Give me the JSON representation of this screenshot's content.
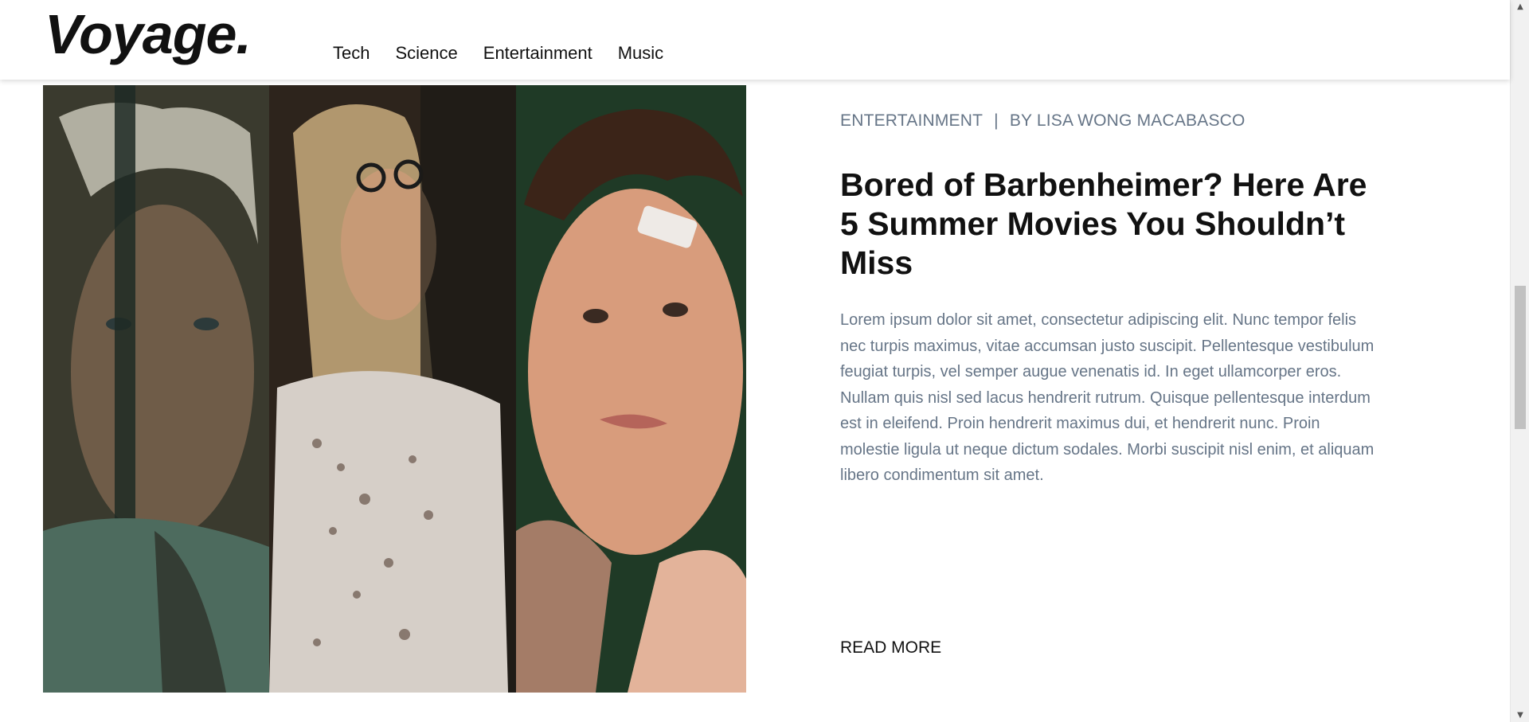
{
  "site": {
    "logo": "Voyage."
  },
  "nav": {
    "items": [
      {
        "label": "Tech"
      },
      {
        "label": "Science"
      },
      {
        "label": "Entertainment"
      },
      {
        "label": "Music"
      }
    ]
  },
  "article": {
    "category": "ENTERTAINMENT",
    "separator": "|",
    "byline": "BY LISA WONG MACABASCO",
    "title": "Bored of Barbenheimer? Here Are 5 Summer Movies You Shouldn’t Miss",
    "excerpt": "Lorem ipsum dolor sit amet, consectetur adipiscing elit. Nunc tempor felis nec turpis maximus, vitae accumsan justo suscipit. Pellentesque vestibulum feugiat turpis, vel semper augue venenatis id. In eget ullamcorper eros. Nullam quis nisl sed lacus hendrerit rutrum. Quisque pellentesque interdum est in eleifend. Proin hendrerit maximus dui, et hendrerit nunc. Proin molestie ligula ut neque dictum sodales. Morbi suscipit nisl enim, et aliquam libero condimentum sit amet.",
    "read_more": "READ MORE"
  },
  "colors": {
    "text": "#111111",
    "muted": "#667587",
    "background": "#ffffff"
  },
  "icons": {
    "scroll_up": "scroll-up-arrow-icon",
    "scroll_down": "scroll-down-arrow-icon"
  }
}
